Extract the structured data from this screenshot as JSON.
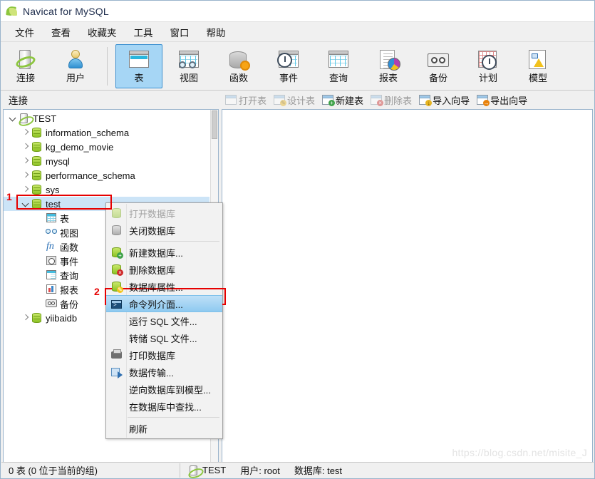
{
  "window": {
    "title": "Navicat for MySQL",
    "logo_icon": "navicat-leaf-icon"
  },
  "menubar": {
    "items": [
      {
        "label": "文件",
        "name": "menu-file"
      },
      {
        "label": "查看",
        "name": "menu-view"
      },
      {
        "label": "收藏夹",
        "name": "menu-favorites"
      },
      {
        "label": "工具",
        "name": "menu-tools"
      },
      {
        "label": "窗口",
        "name": "menu-window"
      },
      {
        "label": "帮助",
        "name": "menu-help"
      }
    ]
  },
  "toolbar": {
    "group1": [
      {
        "label": "连接",
        "icon": "connection-icon",
        "selected": false
      },
      {
        "label": "用户",
        "icon": "user-icon",
        "selected": false
      }
    ],
    "group2": [
      {
        "label": "表",
        "icon": "table-icon",
        "selected": true
      },
      {
        "label": "视图",
        "icon": "view-icon",
        "selected": false
      },
      {
        "label": "函数",
        "icon": "function-icon",
        "selected": false
      },
      {
        "label": "事件",
        "icon": "event-icon",
        "selected": false
      },
      {
        "label": "查询",
        "icon": "query-icon",
        "selected": false
      },
      {
        "label": "报表",
        "icon": "report-icon",
        "selected": false
      },
      {
        "label": "备份",
        "icon": "backup-icon",
        "selected": false
      },
      {
        "label": "计划",
        "icon": "schedule-icon",
        "selected": false
      },
      {
        "label": "模型",
        "icon": "model-icon",
        "selected": false
      }
    ]
  },
  "subtoolbar": {
    "items": [
      {
        "label": "打开表",
        "icon": "open-table-icon",
        "disabled": true
      },
      {
        "label": "设计表",
        "icon": "design-table-icon",
        "disabled": true
      },
      {
        "label": "新建表",
        "icon": "new-table-icon",
        "disabled": false
      },
      {
        "label": "删除表",
        "icon": "delete-table-icon",
        "disabled": true
      },
      {
        "label": "导入向导",
        "icon": "import-wizard-icon",
        "disabled": false
      },
      {
        "label": "导出向导",
        "icon": "export-wizard-icon",
        "disabled": false
      }
    ]
  },
  "left_panel": {
    "header": "连接",
    "tree": [
      {
        "label": "TEST",
        "icon": "server-icon",
        "indent": 0,
        "expander": "open",
        "selected": false
      },
      {
        "label": "information_schema",
        "icon": "database-icon",
        "indent": 1,
        "expander": "closed",
        "selected": false
      },
      {
        "label": "kg_demo_movie",
        "icon": "database-icon",
        "indent": 1,
        "expander": "closed",
        "selected": false
      },
      {
        "label": "mysql",
        "icon": "database-icon",
        "indent": 1,
        "expander": "closed",
        "selected": false
      },
      {
        "label": "performance_schema",
        "icon": "database-icon",
        "indent": 1,
        "expander": "closed",
        "selected": false
      },
      {
        "label": "sys",
        "icon": "database-icon",
        "indent": 1,
        "expander": "closed",
        "selected": false
      },
      {
        "label": "test",
        "icon": "database-icon",
        "indent": 1,
        "expander": "open",
        "selected": true
      },
      {
        "label": "表",
        "icon": "table-node-icon",
        "indent": 2,
        "expander": "none",
        "selected": false
      },
      {
        "label": "视图",
        "icon": "view-node-icon",
        "indent": 2,
        "expander": "none",
        "selected": false
      },
      {
        "label": "函数",
        "icon": "function-node-icon",
        "indent": 2,
        "expander": "none",
        "selected": false
      },
      {
        "label": "事件",
        "icon": "event-node-icon",
        "indent": 2,
        "expander": "none",
        "selected": false
      },
      {
        "label": "查询",
        "icon": "query-node-icon",
        "indent": 2,
        "expander": "none",
        "selected": false
      },
      {
        "label": "报表",
        "icon": "report-node-icon",
        "indent": 2,
        "expander": "none",
        "selected": false
      },
      {
        "label": "备份",
        "icon": "backup-node-icon",
        "indent": 2,
        "expander": "none",
        "selected": false
      },
      {
        "label": "yiibaidb",
        "icon": "database-icon",
        "indent": 1,
        "expander": "closed",
        "selected": false
      }
    ]
  },
  "context_menu": {
    "items": [
      {
        "label": "打开数据库",
        "icon": "database-open-icon",
        "state": "disabled"
      },
      {
        "label": "关闭数据库",
        "icon": "database-closed-icon",
        "state": "normal"
      },
      {
        "separator_after": true
      },
      {
        "label": "新建数据库...",
        "icon": "database-new-icon",
        "state": "normal"
      },
      {
        "label": "删除数据库",
        "icon": "database-delete-icon",
        "state": "normal"
      },
      {
        "label": "数据库属性...",
        "icon": "database-properties-icon",
        "state": "normal"
      },
      {
        "label": "命令列介面...",
        "icon": "console-icon",
        "state": "highlight"
      },
      {
        "label": "运行 SQL 文件...",
        "icon": "none",
        "state": "normal"
      },
      {
        "label": "转储 SQL 文件...",
        "icon": "none",
        "state": "normal"
      },
      {
        "label": "打印数据库",
        "icon": "printer-icon",
        "state": "normal"
      },
      {
        "label": "数据传输...",
        "icon": "data-transfer-icon",
        "state": "normal"
      },
      {
        "label": "逆向数据库到模型...",
        "icon": "none",
        "state": "normal"
      },
      {
        "label": "在数据库中查找...",
        "icon": "none",
        "state": "normal"
      },
      {
        "separator_after": true
      },
      {
        "label": "刷新",
        "icon": "none",
        "state": "normal"
      }
    ]
  },
  "annotations": [
    {
      "number": "1",
      "target": "tree-item-test"
    },
    {
      "number": "2",
      "target": "context-menu-item-console"
    }
  ],
  "statusbar": {
    "count_text": "0 表 (0 位于当前的组)",
    "server": "TEST",
    "user": "用户: root",
    "database": "数据库: test",
    "server_icon": "server-icon"
  },
  "watermark": "https://blog.csdn.net/misite_J",
  "colors": {
    "selection_blue": "#cce4f7",
    "menu_highlight": "#8ecaf0",
    "annotation_red": "#e60000",
    "toolbar_selected": "#a6d6f5"
  }
}
